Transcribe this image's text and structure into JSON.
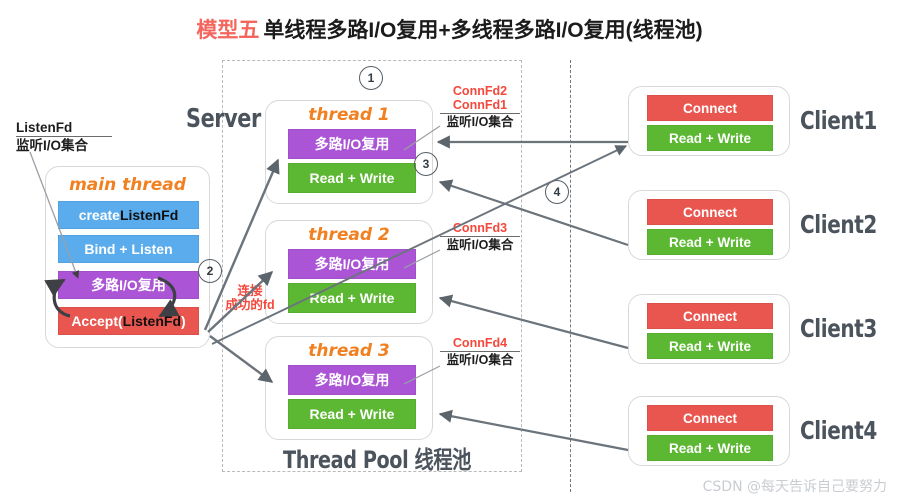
{
  "title": {
    "model": "模型五",
    "text": "单线程多路I/O复用+多线程多路I/O复用(线程池)"
  },
  "labels": {
    "server": "Server",
    "thread_pool": "Thread Pool 线程池",
    "listenfd_name": "ListenFd",
    "listenfd_set": "监听I/O集合",
    "connect_fd_note_line1": "连接",
    "connect_fd_note_line2": "成功的fd"
  },
  "main_thread": {
    "title": "main thread",
    "rows": [
      {
        "text_white": "create ",
        "text_black": "ListenFd",
        "color": "blue"
      },
      {
        "text_white": "Bind + Listen",
        "text_black": "",
        "color": "blue"
      },
      {
        "text_white": "多路I/O复用",
        "text_black": "",
        "color": "purple"
      },
      {
        "text_white": "Accept(",
        "text_black": "ListenFd",
        "text_white2": ")",
        "color": "red"
      }
    ]
  },
  "threads": [
    {
      "title": "thread 1",
      "mux_label": "多路I/O复用",
      "rw_label": "Read + Write",
      "fd_lines": [
        "ConnFd2",
        "ConnFd1"
      ],
      "fd_set": "监听I/O集合"
    },
    {
      "title": "thread 2",
      "mux_label": "多路I/O复用",
      "rw_label": "Read + Write",
      "fd_lines": [
        "ConnFd3"
      ],
      "fd_set": "监听I/O集合"
    },
    {
      "title": "thread 3",
      "mux_label": "多路I/O复用",
      "rw_label": "Read + Write",
      "fd_lines": [
        "ConnFd4"
      ],
      "fd_set": "监听I/O集合"
    }
  ],
  "clients": [
    {
      "name": "Client1",
      "connect_label": "Connect",
      "rw_label": "Read + Write"
    },
    {
      "name": "Client2",
      "connect_label": "Connect",
      "rw_label": "Read + Write"
    },
    {
      "name": "Client3",
      "connect_label": "Connect",
      "rw_label": "Read + Write"
    },
    {
      "name": "Client4",
      "connect_label": "Connect",
      "rw_label": "Read + Write"
    }
  ],
  "steps": [
    "1",
    "2",
    "3",
    "4"
  ],
  "watermark": "CSDN @每天告诉自己要努力",
  "colors": {
    "blue": "#5aaced",
    "purple": "#ab55d6",
    "green": "#5cb832",
    "red": "#e8564f",
    "orange": "#f08020",
    "accent_red": "#f4483c",
    "stencil": "#4b535c"
  }
}
